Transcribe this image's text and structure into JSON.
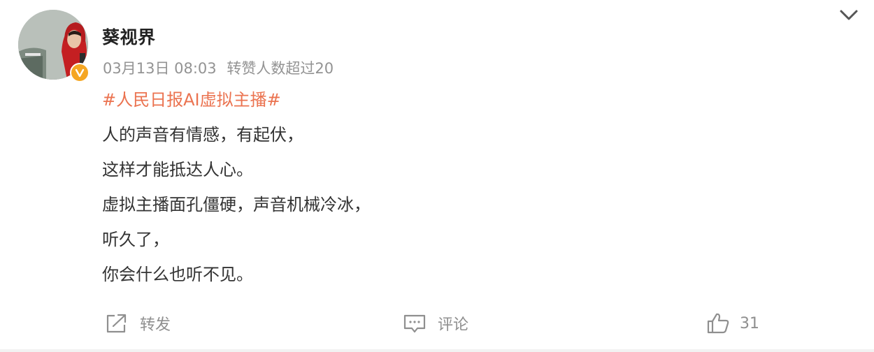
{
  "post": {
    "author": {
      "name": "葵视界",
      "verified_badge": "V",
      "avatar_icon": "avatar-photo"
    },
    "meta": {
      "date": "03月13日 08:03",
      "repost_info": "转赞人数超过20"
    },
    "topic": "#人民日报AI虚拟主播#",
    "lines": [
      "人的声音有情感，有起伏，",
      "这样才能抵达人心。",
      "虚拟主播面孔僵硬，声音机械冷冰，",
      "听久了，",
      "你会什么也听不见。"
    ],
    "actions": {
      "repost_label": "转发",
      "comment_label": "评论",
      "like_count": "31"
    }
  },
  "colors": {
    "topic": "#eb7350",
    "meta": "#939393",
    "badge": "#f5a623",
    "text": "#333333"
  }
}
